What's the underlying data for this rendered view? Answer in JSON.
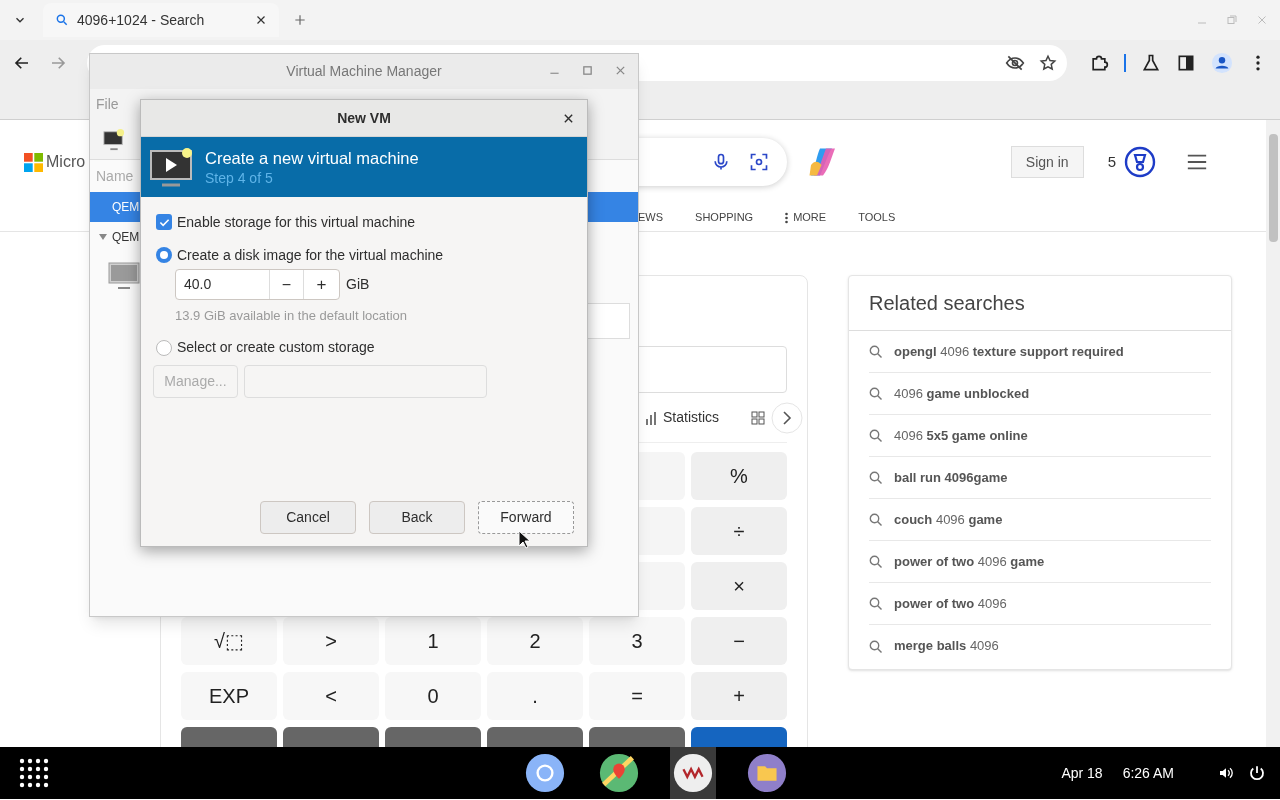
{
  "browser": {
    "tabs": [
      {
        "title": "4096+1024 - Search",
        "selected": true
      }
    ]
  },
  "search_page": {
    "logo_text": "Micro",
    "sign_in": "Sign in",
    "rewards_count": "5",
    "nav": [
      "EWS",
      "SHOPPING",
      "MORE",
      "TOOLS"
    ],
    "calculator": {
      "tabs": [
        "Statistics"
      ],
      "keys": [
        [
          "%"
        ],
        [
          "÷"
        ],
        [
          "×"
        ],
        [
          "√⬚",
          ">",
          "1",
          "2",
          "3",
          "−"
        ],
        [
          "EXP",
          "<",
          "0",
          ".",
          "=",
          "+"
        ]
      ]
    },
    "related": {
      "title": "Related searches",
      "items": [
        "**opengl** 4096 **texture support required**",
        "4096 **game unblocked**",
        "4096 **5x5 game online**",
        "**ball run 4096game**",
        "**couch** 4096 **game**",
        "**power of two** 4096 **game**",
        "**power of two** 4096",
        "**merge balls** 4096"
      ]
    }
  },
  "vmm_window": {
    "title": "Virtual Machine Manager",
    "menu": [
      "File"
    ],
    "column": "Name",
    "rows": [
      {
        "kind": "connection",
        "label": "QEM",
        "selected": true
      },
      {
        "kind": "group",
        "label": "QEM",
        "selected": false,
        "expanded": true
      },
      {
        "kind": "vm",
        "selected": false
      }
    ]
  },
  "dialog": {
    "title": "New VM",
    "header": {
      "title": "Create a new virtual machine",
      "step": "Step 4 of 5"
    },
    "enable_storage": {
      "label": "Enable storage for this virtual machine",
      "checked": true
    },
    "options": [
      {
        "label": "Create a disk image for the virtual machine",
        "selected": true
      },
      {
        "label": "Select or create custom storage",
        "selected": false
      }
    ],
    "size": {
      "value": "40.0",
      "decrement": "−",
      "increment": "+",
      "unit": "GiB"
    },
    "hint": "13.9 GiB available in the default location",
    "manage": {
      "label": "Manage...",
      "disabled": true
    },
    "buttons": [
      {
        "label": "Cancel",
        "focused": false
      },
      {
        "label": "Back",
        "focused": false
      },
      {
        "label": "Forward",
        "focused": true
      }
    ]
  },
  "taskbar": {
    "apps": [
      {
        "kind": "browser",
        "active": false
      },
      {
        "kind": "maps",
        "active": false
      },
      {
        "kind": "vm",
        "active": true
      },
      {
        "kind": "files",
        "active": false
      }
    ],
    "date": "Apr 18",
    "time": "6:26 AM"
  }
}
